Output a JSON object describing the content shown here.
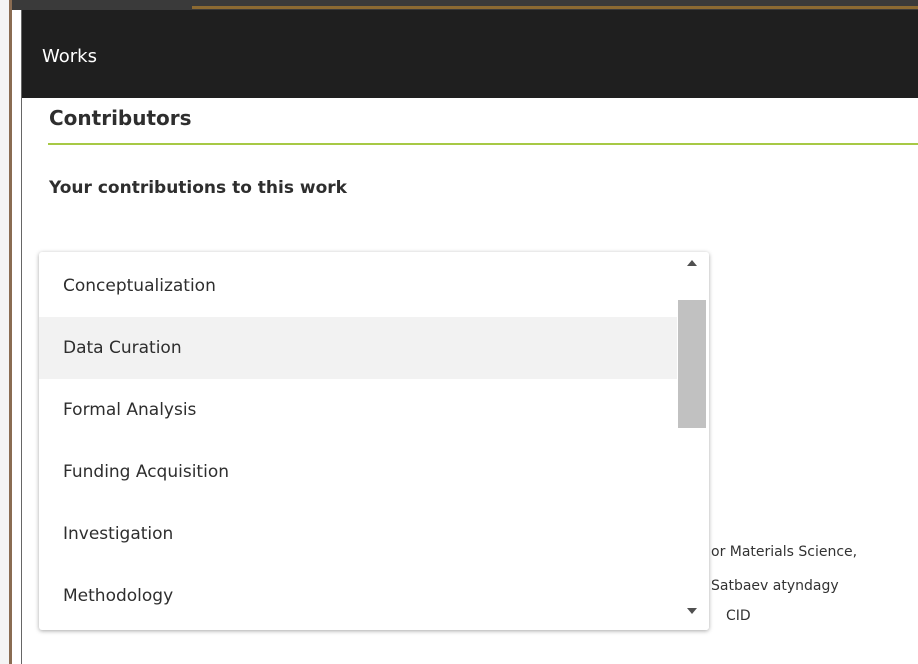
{
  "modal": {
    "title": "Works"
  },
  "contributors": {
    "section_title": "Contributors",
    "subheading": "Your contributions to this work"
  },
  "roles_dropdown": {
    "options": [
      "Conceptualization",
      "Data Curation",
      "Formal Analysis",
      "Funding Acquisition",
      "Investigation",
      "Methodology"
    ],
    "hovered_option": "Data Curation"
  },
  "background_text": {
    "lines": [
      "or Materials Science,",
      " Satbaev atyndagy",
      "CID"
    ]
  },
  "colors": {
    "header_bg": "#1f1f1f",
    "accent_underline": "#a7c945",
    "hover_bg": "#f2f2f2"
  }
}
